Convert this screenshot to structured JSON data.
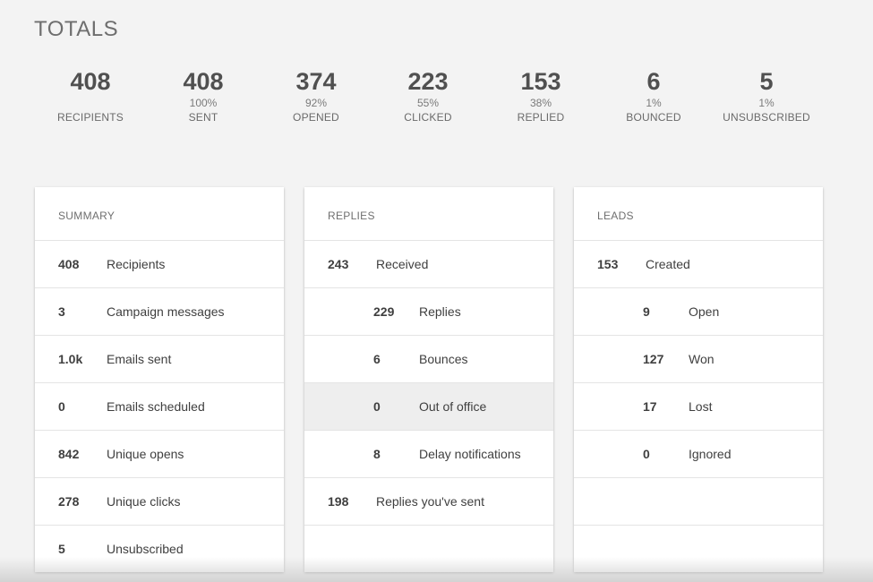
{
  "totals": {
    "title": "TOTALS",
    "stats": [
      {
        "value": "408",
        "pct": "",
        "label": "RECIPIENTS"
      },
      {
        "value": "408",
        "pct": "100%",
        "label": "SENT"
      },
      {
        "value": "374",
        "pct": "92%",
        "label": "OPENED"
      },
      {
        "value": "223",
        "pct": "55%",
        "label": "CLICKED"
      },
      {
        "value": "153",
        "pct": "38%",
        "label": "REPLIED"
      },
      {
        "value": "6",
        "pct": "1%",
        "label": "BOUNCED"
      },
      {
        "value": "5",
        "pct": "1%",
        "label": "UNSUBSCRIBED"
      }
    ]
  },
  "summary": {
    "title": "SUMMARY",
    "rows": [
      {
        "num": "408",
        "label": "Recipients"
      },
      {
        "num": "3",
        "label": "Campaign messages"
      },
      {
        "num": "1.0k",
        "label": "Emails sent"
      },
      {
        "num": "0",
        "label": "Emails scheduled"
      },
      {
        "num": "842",
        "label": "Unique opens"
      },
      {
        "num": "278",
        "label": "Unique clicks"
      },
      {
        "num": "5",
        "label": "Unsubscribed"
      }
    ]
  },
  "replies": {
    "title": "REPLIES",
    "rows": [
      {
        "num": "243",
        "label": "Received"
      },
      {
        "num": "229",
        "label": "Replies"
      },
      {
        "num": "6",
        "label": "Bounces"
      },
      {
        "num": "0",
        "label": "Out of office"
      },
      {
        "num": "8",
        "label": "Delay notifications"
      },
      {
        "num": "198",
        "label": "Replies you've sent"
      }
    ]
  },
  "leads": {
    "title": "LEADS",
    "rows": [
      {
        "num": "153",
        "label": "Created"
      },
      {
        "num": "9",
        "label": "Open"
      },
      {
        "num": "127",
        "label": "Won"
      },
      {
        "num": "17",
        "label": "Lost"
      },
      {
        "num": "0",
        "label": "Ignored"
      }
    ]
  }
}
